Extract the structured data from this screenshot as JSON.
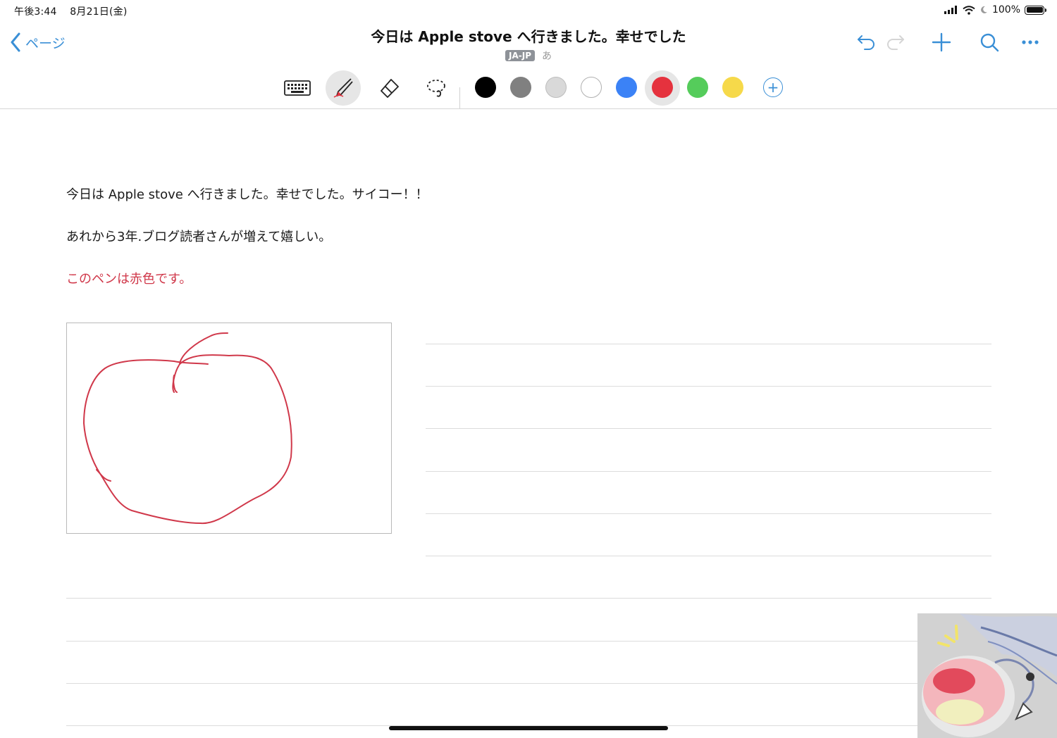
{
  "status_bar": {
    "time": "午後3:44",
    "date": "8月21日(金)",
    "battery": "100%"
  },
  "nav": {
    "back_label": "ページ",
    "title": "今日は Apple stove へ行きました。幸せでした",
    "language_badge": "JA-JP",
    "kana_toggle": "あ"
  },
  "toolbar": {
    "tools": [
      "keyboard",
      "pen",
      "eraser",
      "lasso"
    ],
    "selected_tool": "pen",
    "colors": [
      "#000000",
      "#808080",
      "#d9d9d9",
      "#ffffff",
      "#3b82f6",
      "#e5323e",
      "#55cc5b",
      "#f6d94a"
    ],
    "selected_color": "#e5323e",
    "add_color_label": "+"
  },
  "content": {
    "line1": "今日は Apple stove へ行きました。幸せでした。サイコー！！",
    "line2": "あれから3年.ブログ読者さんが増えて嬉しい。",
    "line3": "このペンは赤色です。",
    "line3_color": "#d0384a"
  },
  "accent_color": "#3a8fd6"
}
